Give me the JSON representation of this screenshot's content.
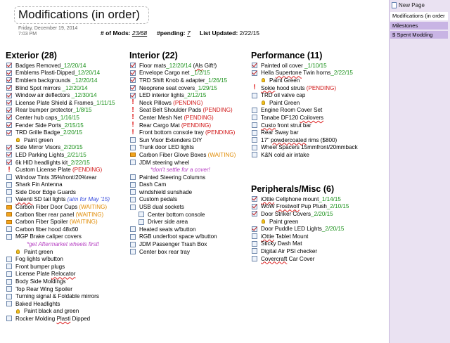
{
  "page": {
    "title": "Modifications (in order)",
    "date": "Friday, December  19, 2014",
    "time": "7:03 PM",
    "mods_label": "# of Mods: ",
    "mods_value": "23/68",
    "pending_label": "#pending: ",
    "pending_value": "7",
    "updated_label": "List Updated: ",
    "updated_value": "2/22/15"
  },
  "sidebar": {
    "new_page": "New Page",
    "pages": [
      {
        "label": "Modifications (in order",
        "active": true
      },
      {
        "label": "Milestones",
        "active": false
      },
      {
        "label": "$ Spent Modding",
        "active": false
      }
    ]
  },
  "columns": [
    {
      "id": "exterior",
      "heading": "Exterior (28)",
      "items": [
        {
          "icon": "checked",
          "parts": [
            {
              "t": "Badges Removed"
            },
            {
              "t": "_12/20/14",
              "s": "date"
            }
          ]
        },
        {
          "icon": "checked",
          "parts": [
            {
              "t": "Emblems Plasti-Dipped"
            },
            {
              "t": "_12/20/14",
              "s": "date"
            }
          ]
        },
        {
          "icon": "checked",
          "parts": [
            {
              "t": "Emblem backgrounds "
            },
            {
              "t": "_12/20/14",
              "s": "date"
            }
          ]
        },
        {
          "icon": "checked",
          "parts": [
            {
              "t": "Blind Spot mirrors"
            },
            {
              "t": " _12/20/14",
              "s": "date"
            }
          ]
        },
        {
          "icon": "checked",
          "parts": [
            {
              "t": "Window air deflectors"
            },
            {
              "t": " _12/30/14",
              "s": "date"
            }
          ]
        },
        {
          "icon": "checked",
          "parts": [
            {
              "t": "License Plate Shield & Frames"
            },
            {
              "t": "_1/11/15",
              "s": "date"
            }
          ]
        },
        {
          "icon": "checked",
          "parts": [
            {
              "t": "Rear bumper protector"
            },
            {
              "t": "_1/8/15",
              "s": "date"
            }
          ]
        },
        {
          "icon": "checked",
          "parts": [
            {
              "t": "Center hub caps"
            },
            {
              "t": "_1/16/15",
              "s": "date"
            }
          ]
        },
        {
          "icon": "checked",
          "parts": [
            {
              "t": "Fender Side Ports"
            },
            {
              "t": "_2/15/15",
              "s": "date"
            }
          ]
        },
        {
          "icon": "checked",
          "parts": [
            {
              "t": "TRD Grille Badge"
            },
            {
              "t": "_2/20/15",
              "s": "date"
            }
          ]
        },
        {
          "icon": "bulb",
          "indent": "sub",
          "parts": [
            {
              "t": "Paint green"
            }
          ]
        },
        {
          "icon": "checked",
          "parts": [
            {
              "t": "Side Mirror Visors"
            },
            {
              "t": "_2/20/15",
              "s": "date"
            }
          ]
        },
        {
          "icon": "checked",
          "parts": [
            {
              "t": "LED Parking Lights"
            },
            {
              "t": "_2/21/15",
              "s": "date"
            }
          ]
        },
        {
          "icon": "checked",
          "parts": [
            {
              "t": "6k HID headlights kit"
            },
            {
              "t": "_2/22/15",
              "s": "date"
            }
          ]
        },
        {
          "icon": "excl",
          "parts": [
            {
              "t": "Custom License Plate  "
            },
            {
              "t": "(PENDING)",
              "s": "pend"
            }
          ]
        },
        {
          "icon": "unchecked",
          "parts": [
            {
              "t": "Window Tints 35%front/20%rear"
            }
          ]
        },
        {
          "icon": "unchecked",
          "parts": [
            {
              "t": "Shark Fin Antenna"
            }
          ]
        },
        {
          "icon": "unchecked",
          "parts": [
            {
              "t": "Side Door Edge Guards"
            }
          ]
        },
        {
          "icon": "unchecked",
          "parts": [
            {
              "t": "Valenti",
              "s": "sq"
            },
            {
              "t": " SD tail lights  "
            },
            {
              "t": "(aim for May '15)",
              "s": "aim"
            }
          ]
        },
        {
          "icon": "flag",
          "parts": [
            {
              "t": "Carbon Fiber Door Cups "
            },
            {
              "t": "(WAITING)",
              "s": "wait"
            }
          ]
        },
        {
          "icon": "flag",
          "parts": [
            {
              "t": "Carbon fiber rear panel "
            },
            {
              "t": "(WAITING)",
              "s": "wait"
            }
          ]
        },
        {
          "icon": "flag",
          "parts": [
            {
              "t": "Carbon Fiber  Spoiler "
            },
            {
              "t": "(WAITING)",
              "s": "wait"
            }
          ]
        },
        {
          "icon": "unchecked",
          "parts": [
            {
              "t": "Carbon fiber hood 48x60"
            }
          ]
        },
        {
          "icon": "unchecked",
          "parts": [
            {
              "t": "MGP Brake caliper covers"
            }
          ]
        },
        {
          "icon": "none",
          "indent": "note",
          "parts": [
            {
              "t": "*get Aftermarket wheels first!",
              "s": "pink"
            }
          ]
        },
        {
          "icon": "bulb",
          "indent": "sub",
          "parts": [
            {
              "t": "Paint green"
            }
          ]
        },
        {
          "icon": "unchecked",
          "parts": [
            {
              "t": "Fog lights w/button"
            }
          ]
        },
        {
          "icon": "unchecked",
          "parts": [
            {
              "t": "Front bumper plugs"
            }
          ]
        },
        {
          "icon": "unchecked",
          "parts": [
            {
              "t": "License Plate "
            },
            {
              "t": "Relocator",
              "s": "sq"
            }
          ]
        },
        {
          "icon": "unchecked",
          "parts": [
            {
              "t": "Body Side Moldings"
            }
          ]
        },
        {
          "icon": "unchecked",
          "parts": [
            {
              "t": "Top Rear Wing Spoiler"
            }
          ]
        },
        {
          "icon": "unchecked",
          "parts": [
            {
              "t": "Turning signal & Foldable mirrors"
            }
          ]
        },
        {
          "icon": "unchecked",
          "parts": [
            {
              "t": "Baked Headlights"
            }
          ]
        },
        {
          "icon": "bulb",
          "indent": "sub",
          "parts": [
            {
              "t": "Paint black and green"
            }
          ]
        },
        {
          "icon": "unchecked",
          "parts": [
            {
              "t": "Rocker Molding "
            },
            {
              "t": "Plasti",
              "s": "sq"
            },
            {
              "t": " Dipped"
            }
          ]
        }
      ]
    },
    {
      "id": "interior",
      "heading": "Interior (22)",
      "items": [
        {
          "icon": "checked",
          "parts": [
            {
              "t": "Floor mats"
            },
            {
              "t": "_12/20/14",
              "s": "date"
            },
            {
              "t": " ("
            },
            {
              "t": "Als",
              "s": "sq"
            },
            {
              "t": " Gift!)"
            }
          ]
        },
        {
          "icon": "checked",
          "parts": [
            {
              "t": "Envelope Cargo net "
            },
            {
              "t": "_1/2/15",
              "s": "date"
            }
          ]
        },
        {
          "icon": "checked",
          "parts": [
            {
              "t": "TRD Shift Knob & adapter"
            },
            {
              "t": "_1/26/15",
              "s": "date"
            }
          ]
        },
        {
          "icon": "checked",
          "parts": [
            {
              "t": "Neoprene seat covers"
            },
            {
              "t": "_1/29/15",
              "s": "date"
            }
          ]
        },
        {
          "icon": "checked",
          "parts": [
            {
              "t": "LED interior lights"
            },
            {
              "t": "_2/12/15",
              "s": "date"
            }
          ]
        },
        {
          "icon": "excl",
          "parts": [
            {
              "t": "Neck Pillows "
            },
            {
              "t": "(PENDING)",
              "s": "pend"
            }
          ]
        },
        {
          "icon": "excl",
          "parts": [
            {
              "t": "Seat Belt Shoulder Pads "
            },
            {
              "t": "(PENDING)",
              "s": "pend"
            }
          ]
        },
        {
          "icon": "excl",
          "parts": [
            {
              "t": "Center Mesh Net "
            },
            {
              "t": "(PENDING)",
              "s": "pend"
            }
          ]
        },
        {
          "icon": "excl",
          "parts": [
            {
              "t": "Rear Cargo Mat "
            },
            {
              "t": "(PENDING)",
              "s": "pend"
            }
          ]
        },
        {
          "icon": "excl",
          "parts": [
            {
              "t": "Front bottom console tray "
            },
            {
              "t": "(PENDING)",
              "s": "pend"
            }
          ]
        },
        {
          "icon": "unchecked",
          "parts": [
            {
              "t": "Sun Visor Extenders DIY"
            }
          ]
        },
        {
          "icon": "unchecked",
          "parts": [
            {
              "t": "Trunk door LED lights"
            }
          ]
        },
        {
          "icon": "flag",
          "parts": [
            {
              "t": "Carbon Fiber Glove Boxes "
            },
            {
              "t": "(WAITING)",
              "s": "wait"
            }
          ]
        },
        {
          "icon": "unchecked",
          "parts": [
            {
              "t": "JDM steering wheel"
            }
          ]
        },
        {
          "icon": "none",
          "indent": "note",
          "parts": [
            {
              "t": "*don't settle for a cover!",
              "s": "pink"
            }
          ]
        },
        {
          "icon": "unchecked",
          "parts": [
            {
              "t": "Painted Steering Columns"
            }
          ]
        },
        {
          "icon": "unchecked",
          "parts": [
            {
              "t": "Dash Cam"
            }
          ]
        },
        {
          "icon": "unchecked",
          "parts": [
            {
              "t": "windshield sunshade"
            }
          ]
        },
        {
          "icon": "unchecked",
          "parts": [
            {
              "t": "Custom pedals"
            }
          ]
        },
        {
          "icon": "unchecked",
          "parts": [
            {
              "t": "USB dual sockets"
            }
          ]
        },
        {
          "icon": "unchecked",
          "indent": "sub",
          "parts": [
            {
              "t": "Center bottom console"
            }
          ]
        },
        {
          "icon": "unchecked",
          "indent": "sub",
          "parts": [
            {
              "t": "Driver side area"
            }
          ]
        },
        {
          "icon": "unchecked",
          "parts": [
            {
              "t": "Heated seats w/button"
            }
          ]
        },
        {
          "icon": "unchecked",
          "parts": [
            {
              "t": "RGB underfoot space w/button"
            }
          ]
        },
        {
          "icon": "unchecked",
          "parts": [
            {
              "t": "JDM Passenger Trash Box"
            }
          ]
        },
        {
          "icon": "unchecked",
          "parts": [
            {
              "t": "Center box rear tray"
            }
          ]
        }
      ]
    },
    {
      "id": "performance",
      "heading": "Performance (11)",
      "items": [
        {
          "icon": "checked",
          "parts": [
            {
              "t": "Painted oil cover "
            },
            {
              "t": "_1/10/15",
              "s": "date"
            }
          ]
        },
        {
          "icon": "checked",
          "parts": [
            {
              "t": "Hella "
            },
            {
              "t": "Supertone",
              "s": "sq"
            },
            {
              "t": " Twin horns"
            },
            {
              "t": "_2/22/15",
              "s": "date"
            }
          ]
        },
        {
          "icon": "bulb",
          "indent": "sub",
          "parts": [
            {
              "t": "Paint Green"
            }
          ]
        },
        {
          "icon": "excl",
          "parts": [
            {
              "t": "Sokie",
              "s": "sq"
            },
            {
              "t": " hood struts "
            },
            {
              "t": "(PENDING)",
              "s": "pend"
            }
          ]
        },
        {
          "icon": "unchecked",
          "parts": [
            {
              "t": "TRD oil valve cap"
            }
          ]
        },
        {
          "icon": "bulb",
          "indent": "sub",
          "parts": [
            {
              "t": "Paint Green"
            }
          ]
        },
        {
          "icon": "unchecked",
          "parts": [
            {
              "t": "Engine Room Cover Set"
            }
          ]
        },
        {
          "icon": "unchecked",
          "parts": [
            {
              "t": "Tanabe DF120 "
            },
            {
              "t": "Coilovers",
              "s": "sq"
            }
          ]
        },
        {
          "icon": "unchecked",
          "parts": [
            {
              "t": "Custo",
              "s": "sq"
            },
            {
              "t": " front strut bar"
            }
          ]
        },
        {
          "icon": "unchecked",
          "parts": [
            {
              "t": "Rear Sway bar"
            }
          ]
        },
        {
          "icon": "excl-cb",
          "parts": [
            {
              "t": "17\"  "
            },
            {
              "t": "powdercoated",
              "s": "sq"
            },
            {
              "t": " rims ($800)"
            }
          ]
        },
        {
          "icon": "unchecked",
          "parts": [
            {
              "t": "Wheel Spacers 15mmfront/20mmback"
            }
          ]
        },
        {
          "icon": "unchecked",
          "parts": [
            {
              "t": "K&N cold air intake"
            }
          ]
        }
      ]
    },
    {
      "id": "peripherals",
      "heading": "Peripherals/Misc (6)",
      "items": [
        {
          "icon": "checked",
          "parts": [
            {
              "t": "iOttie",
              "s": "sq"
            },
            {
              "t": " Cellphone mount"
            },
            {
              "t": "_1/14/15",
              "s": "date"
            }
          ]
        },
        {
          "icon": "checked",
          "parts": [
            {
              "t": "WoW "
            },
            {
              "t": "Frostwolf",
              "s": "sq"
            },
            {
              "t": " Pup Plush"
            },
            {
              "t": "_2/10/15",
              "s": "date"
            }
          ]
        },
        {
          "icon": "checked",
          "parts": [
            {
              "t": "Door Striker Covers"
            },
            {
              "t": "_2/20/15",
              "s": "date"
            }
          ]
        },
        {
          "icon": "bulb",
          "indent": "sub",
          "parts": [
            {
              "t": "Paint green"
            }
          ]
        },
        {
          "icon": "checked",
          "parts": [
            {
              "t": "Door Puddle LED Lights"
            },
            {
              "t": "_2/20/15",
              "s": "date"
            }
          ]
        },
        {
          "icon": "unchecked",
          "parts": [
            {
              "t": "iOttie",
              "s": "sq"
            },
            {
              "t": " Tablet Mount"
            }
          ]
        },
        {
          "icon": "unchecked",
          "parts": [
            {
              "t": "Sticky Dash Mat"
            }
          ]
        },
        {
          "icon": "unchecked",
          "parts": [
            {
              "t": "Digital Air PSI checker"
            }
          ]
        },
        {
          "icon": "unchecked",
          "parts": [
            {
              "t": "Covercraft",
              "s": "sq"
            },
            {
              "t": " Car Cover"
            }
          ]
        }
      ]
    }
  ]
}
